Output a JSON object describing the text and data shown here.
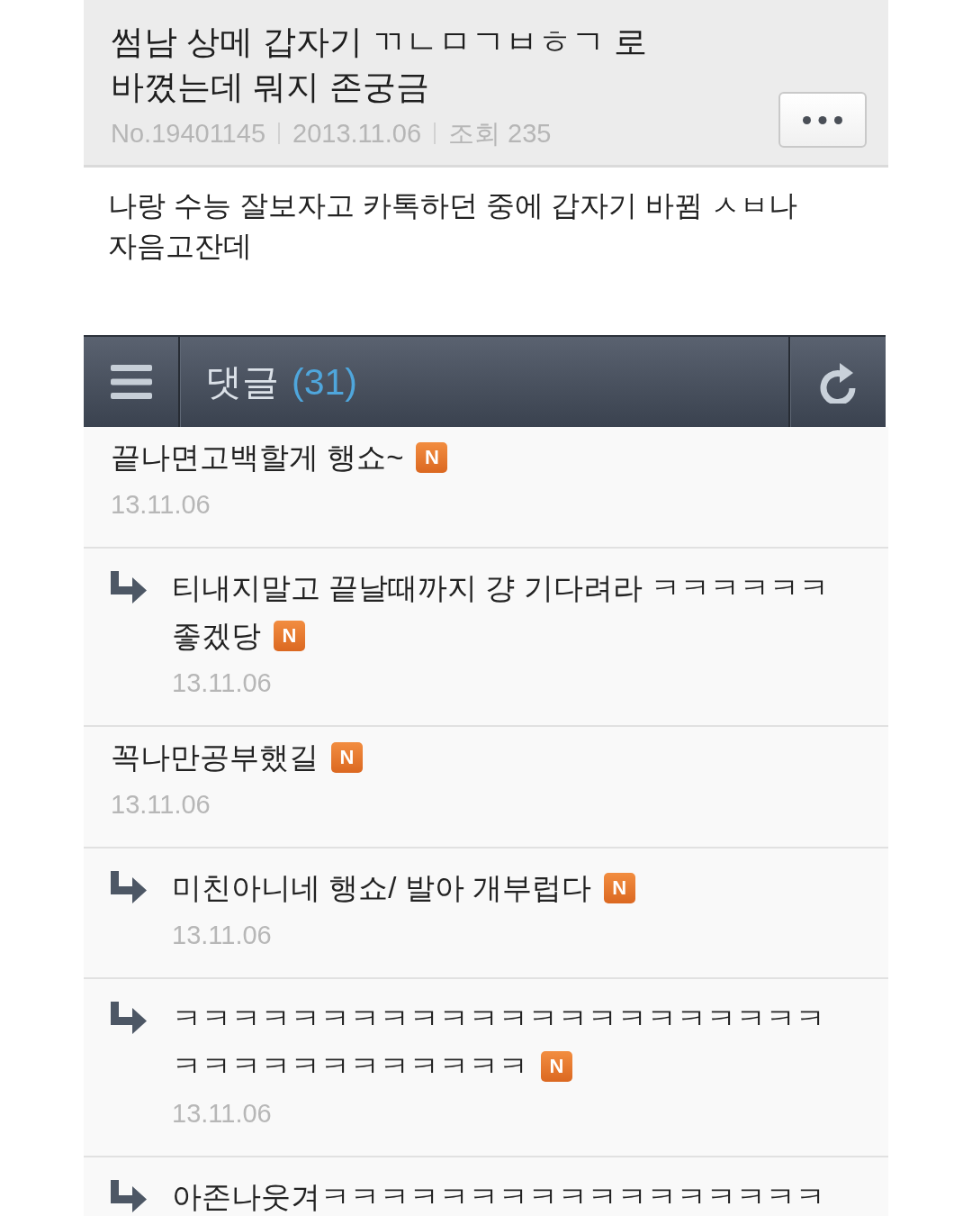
{
  "post": {
    "title": "썸남 상메 갑자기 ㄲㄴㅁㄱㅂㅎㄱ 로 바꼈는데 뭐지 존궁금",
    "number": "No.19401145",
    "date": "2013.11.06",
    "views": "조회 235",
    "body": "나랑 수능 잘보자고 카톡하던 중에 갑자기 바뀜 ㅅㅂ나자음고잔데"
  },
  "comments_bar": {
    "title": "댓글",
    "count": "(31)"
  },
  "comments": [
    {
      "kind": "comment",
      "lines": [
        "끝나면고백할게 행쇼~"
      ],
      "badge": "N",
      "date": "13.11.06"
    },
    {
      "kind": "reply",
      "lines": [
        "티내지말고 끝날때까지 걍 기다려라 ㅋㅋㅋㅋㅋㅋ",
        "좋겠당"
      ],
      "badge": "N",
      "date": "13.11.06"
    },
    {
      "kind": "comment",
      "lines": [
        "꼭나만공부했길"
      ],
      "badge": "N",
      "date": "13.11.06"
    },
    {
      "kind": "reply",
      "lines": [
        "미친아니네 행쇼/ 발아 개부럽다"
      ],
      "badge": "N",
      "date": "13.11.06"
    },
    {
      "kind": "reply",
      "lines": [
        "ㅋㅋㅋㅋㅋㅋㅋㅋㅋㅋㅋㅋㅋㅋㅋㅋㅋㅋㅋㅋㅋㅋ",
        "ㅋㅋㅋㅋㅋㅋㅋㅋㅋㅋㅋㅋ"
      ],
      "badge": "N",
      "date": "13.11.06"
    },
    {
      "kind": "reply",
      "lines": [
        "아존나웃겨ㅋㅋㅋㅋㅋㅋㅋㅋㅋㅋㅋㅋㅋㅋㅋㅋㅋ"
      ]
    }
  ]
}
